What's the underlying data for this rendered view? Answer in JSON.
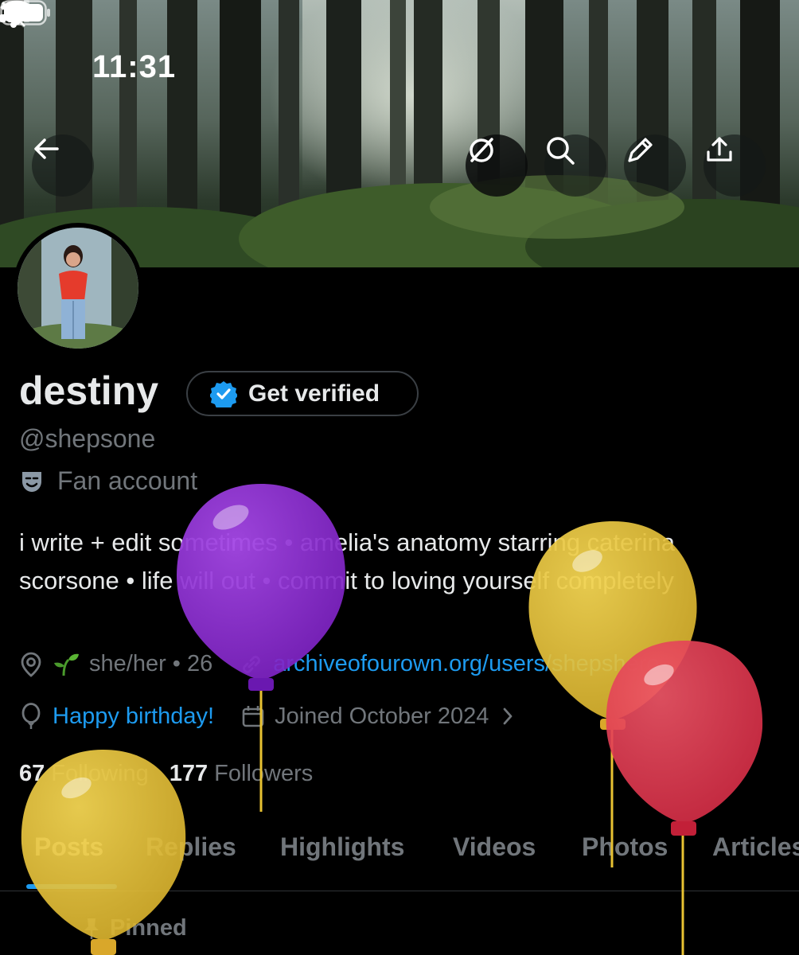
{
  "status_bar": {
    "time": "11:31"
  },
  "profile": {
    "display_name": "destiny",
    "verify_label": "Get verified",
    "handle": "@shepsone",
    "category": "Fan account",
    "bio_line1": "i write + edit sometimes • amelia's anatomy starring caterina",
    "bio_line2": "scorsone • life will out • commit to loving yourself completely",
    "pronouns_age": "she/her • 26",
    "website": "archiveofourown.org/users/shepshero",
    "birthday": "Happy birthday!",
    "joined": "Joined October 2024",
    "following_count": "67",
    "following_label": "Following",
    "followers_count": "177",
    "followers_label": "Followers"
  },
  "tabs": [
    {
      "label": "Posts",
      "active": true
    },
    {
      "label": "Replies"
    },
    {
      "label": "Highlights"
    },
    {
      "label": "Videos"
    },
    {
      "label": "Photos"
    },
    {
      "label": "Articles"
    }
  ],
  "pinned_label": "Pinned",
  "colors": {
    "accent": "#1d9bf0",
    "muted": "#71767b",
    "text": "#e7e9ea",
    "balloon_purple": "#8a2bd0",
    "balloon_yellow": "#e8c232",
    "balloon_red": "#e0384f"
  },
  "icons": [
    "back-arrow-icon",
    "grok-icon",
    "search-icon",
    "edit-icon",
    "share-icon",
    "verified-badge-icon",
    "theater-mask-icon",
    "location-icon",
    "sprout-icon",
    "link-icon",
    "balloon-icon",
    "calendar-icon",
    "chevron-right-icon",
    "pin-icon"
  ]
}
